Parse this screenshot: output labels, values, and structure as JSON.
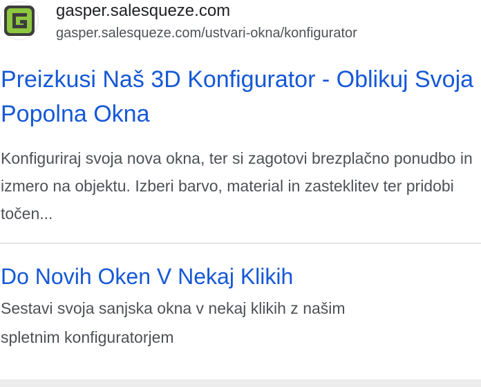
{
  "site": {
    "favicon_icon": "green-g-logo-icon",
    "name": "gasper.salesqueze.com",
    "url": "gasper.salesqueze.com/ustvari-okna/konfigurator"
  },
  "result": {
    "title": "Preizkusi Naš 3D Konfigurator - Oblikuj Svoja Popolna Okna",
    "snippet": "Konfiguriraj svoja nova okna, ter si zagotovi brezplačno ponudbo in izmero na objektu. Izberi barvo, material in zasteklitev ter pridobi točen..."
  },
  "sitelink": {
    "title": "Do Novih Oken V Nekaj Klikih",
    "description": "Sestavi svoja sanjska okna v nekaj klikih z našim spletnim konfiguratorjem"
  },
  "colors": {
    "link_blue": "#1558d6",
    "text_gray": "#4d5156",
    "logo_green": "#8dc63f",
    "logo_dark": "#3d3d3d"
  }
}
